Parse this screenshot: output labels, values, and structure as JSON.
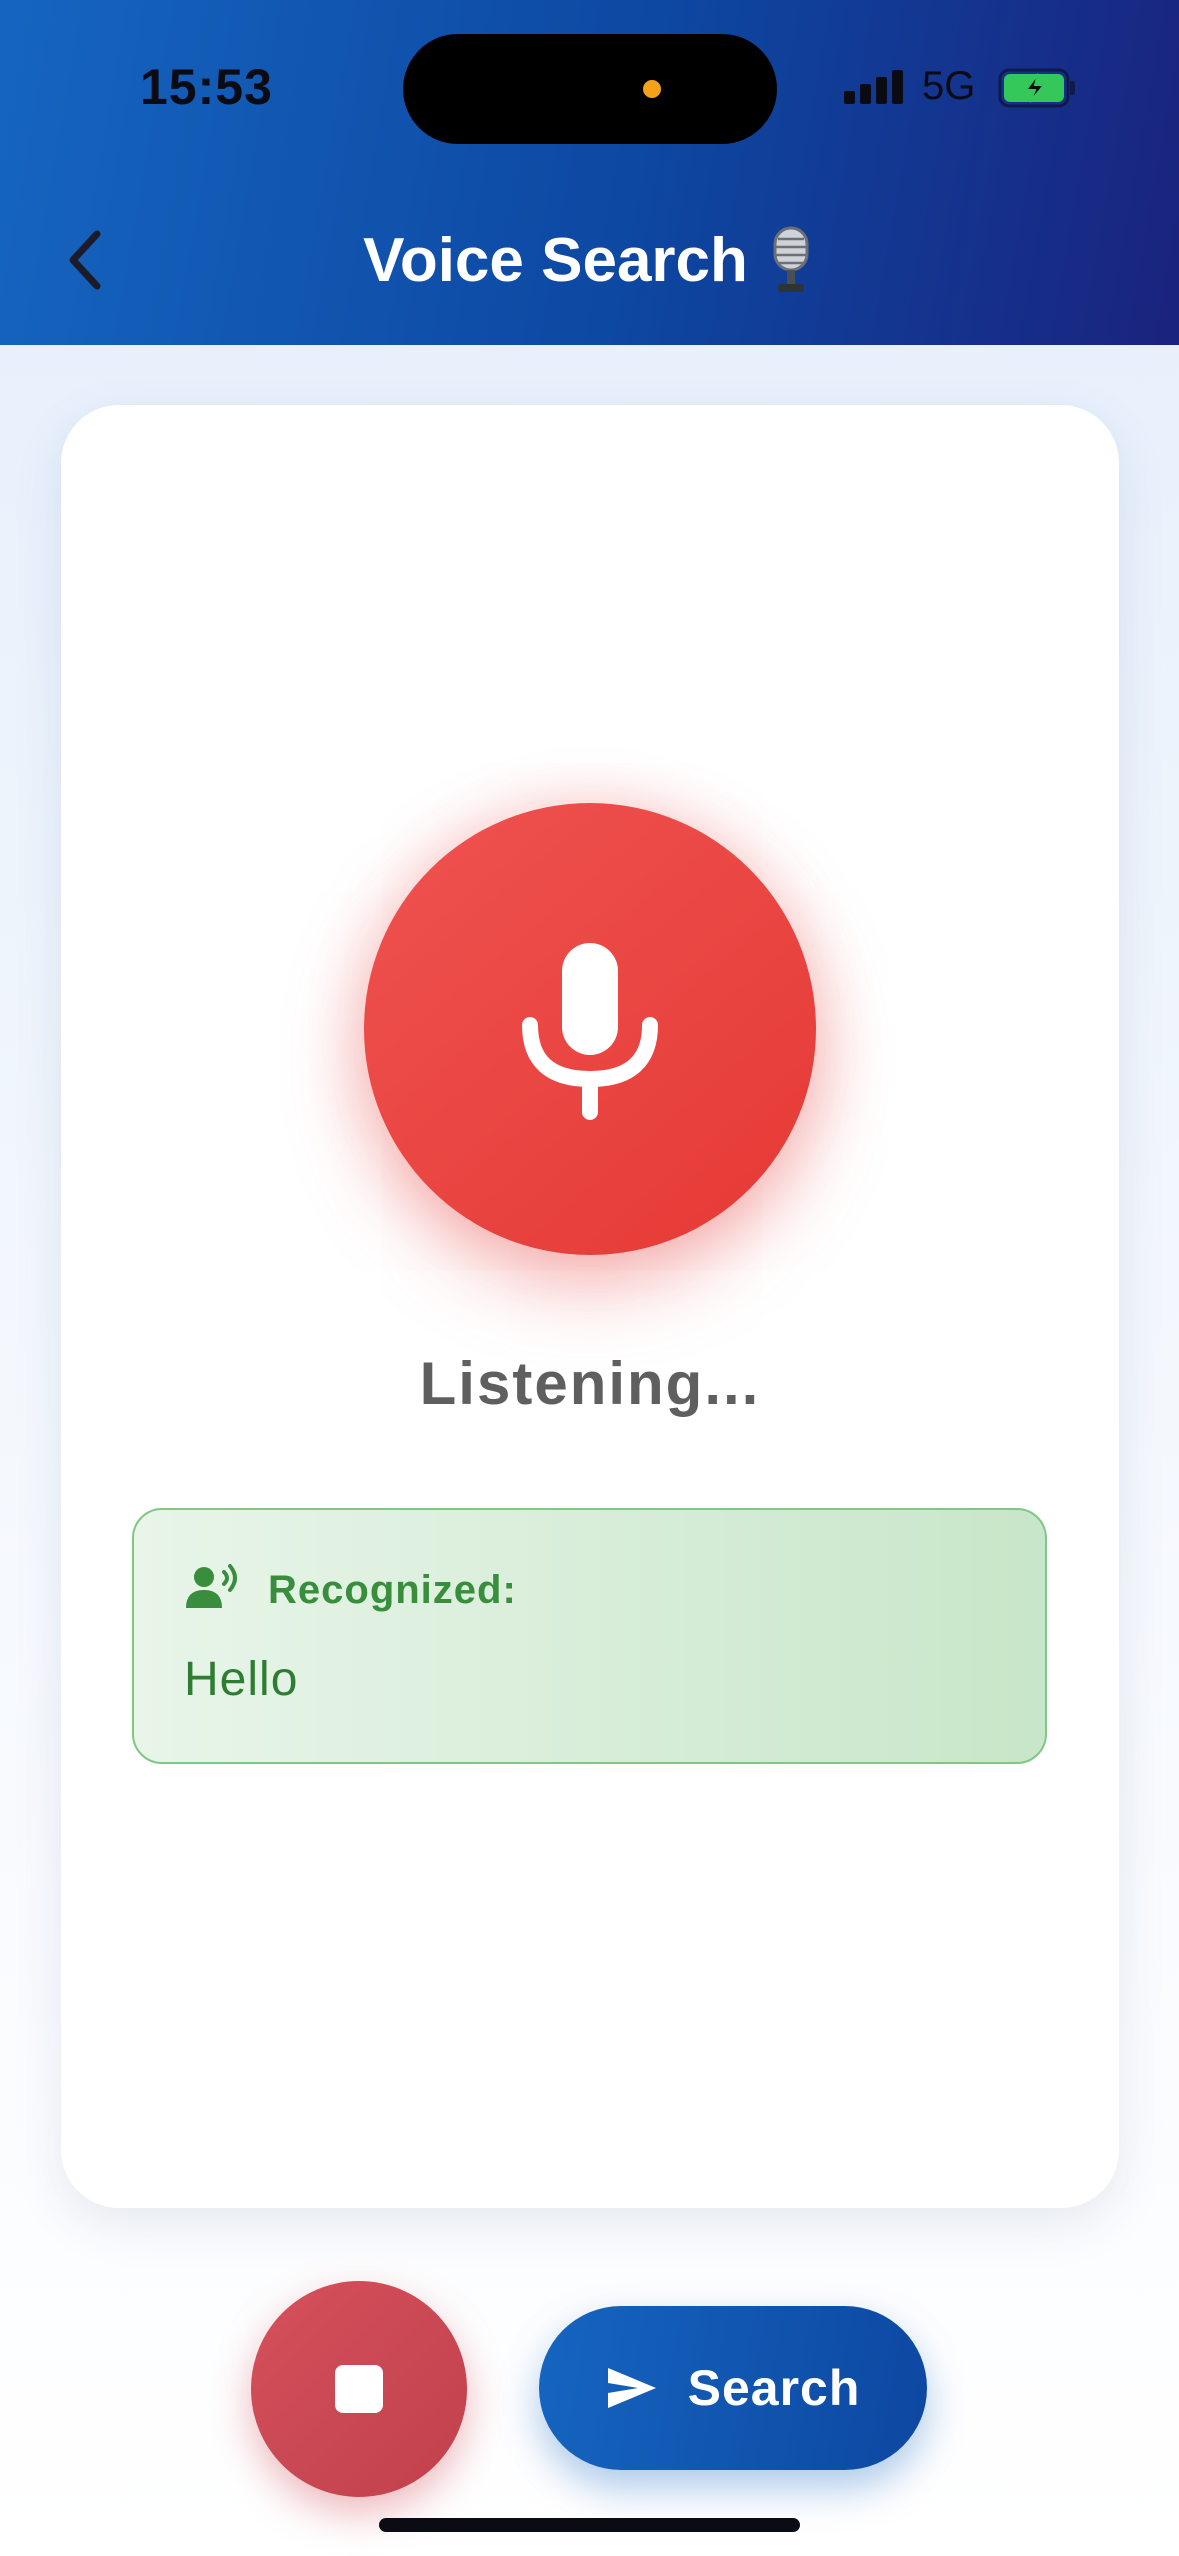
{
  "status_bar": {
    "time": "15:53",
    "network": "5G",
    "signal_icon": "cellular-signal-icon",
    "battery_icon": "battery-charging-icon"
  },
  "header": {
    "title": "Voice Search",
    "back_icon": "chevron-left-icon",
    "title_icon": "studio-microphone-icon"
  },
  "listening": {
    "status": "Listening...",
    "mic_icon": "microphone-icon"
  },
  "recognized": {
    "label": "Recognized:",
    "text": "Hello",
    "icon": "record-voice-icon"
  },
  "actions": {
    "stop_icon": "stop-icon",
    "search_label": "Search",
    "search_icon": "send-icon"
  },
  "colors": {
    "header_gradient_start": "#1565c0",
    "header_gradient_end": "#1a237e",
    "mic_red": "#e53935",
    "recognized_green": "#388e3c",
    "stop_red": "#c8474f",
    "search_blue": "#0d47a1"
  }
}
